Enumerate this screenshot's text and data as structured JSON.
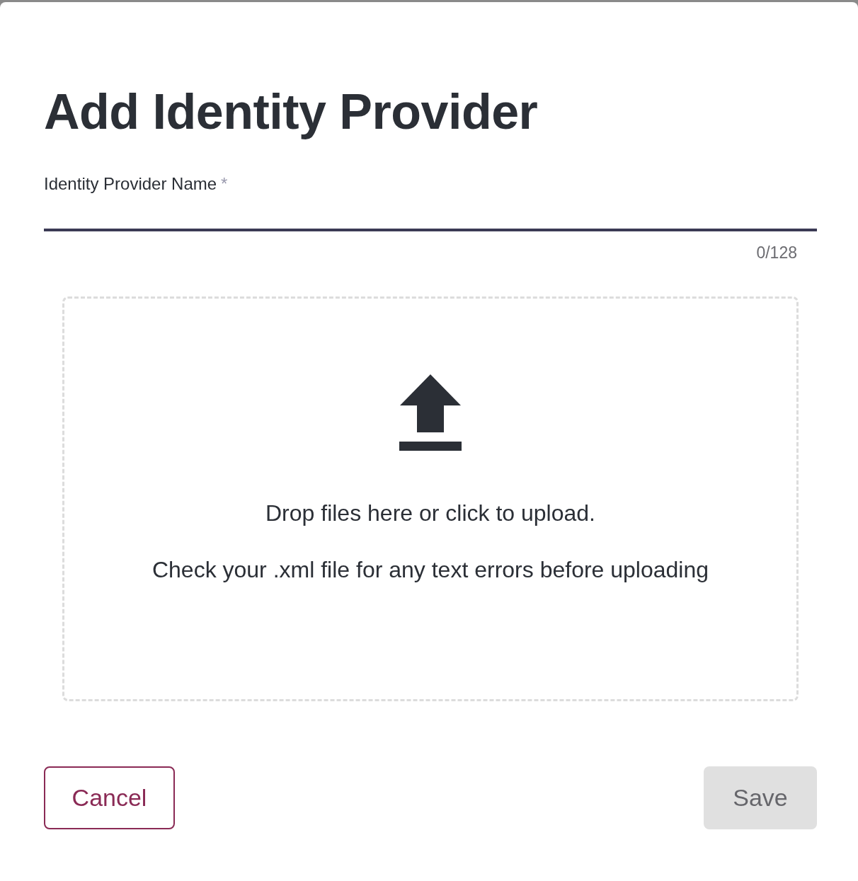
{
  "dialog": {
    "title": "Add Identity Provider"
  },
  "name_field": {
    "label": "Identity Provider Name",
    "required_mark": "*",
    "counter": "0/128"
  },
  "upload": {
    "primary_text": "Drop files here or click to upload.",
    "secondary_text": "Check your .xml file for any text errors before uploading"
  },
  "buttons": [
    {
      "kind": "outline",
      "label": "Cancel",
      "disabled": false
    },
    {
      "kind": "filled",
      "label": "Save",
      "disabled": true
    }
  ]
}
